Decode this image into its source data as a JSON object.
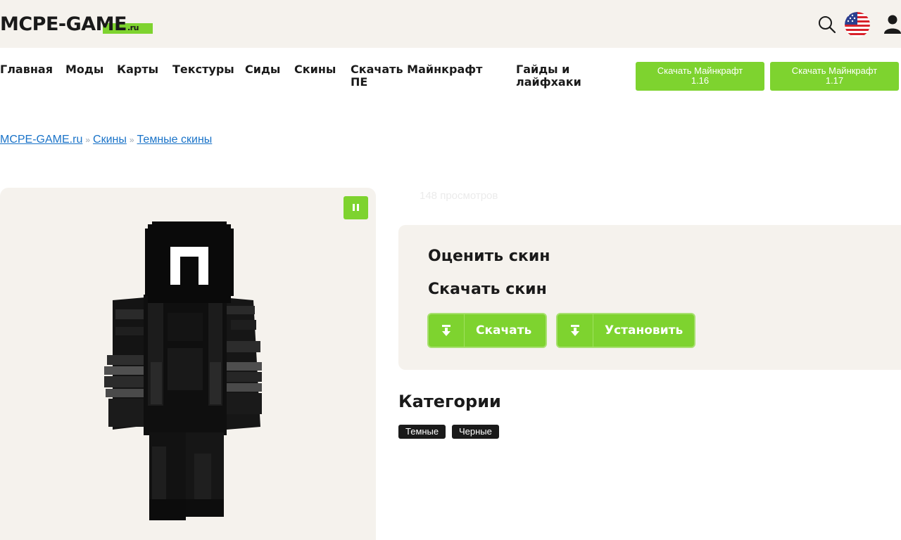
{
  "header": {
    "logo_main": "MCPE-GAME",
    "logo_suffix": ".ru",
    "brand_color": "#7ed32f",
    "icons": [
      "search-icon",
      "us-flag-icon",
      "user-icon"
    ]
  },
  "nav": {
    "items": [
      {
        "label": "Главная"
      },
      {
        "label": "Моды"
      },
      {
        "label": "Карты"
      },
      {
        "label": "Текстуры"
      },
      {
        "label": "Сиды"
      },
      {
        "label": "Скины"
      },
      {
        "label": "Скачать Майнкрафт ПЕ"
      },
      {
        "label": "Гайды и лайфхаки"
      }
    ],
    "buttons": [
      {
        "line1": "Скачать Майнкрафт",
        "line2": "1.16"
      },
      {
        "line1": "Скачать Майнкрафт",
        "line2": "1.17"
      }
    ]
  },
  "breadcrumb": {
    "items": [
      "MCPE-GAME.ru",
      "Скины",
      "Темные скины"
    ],
    "separator": "»"
  },
  "preview": {
    "pause_icon": "pause-icon"
  },
  "views": "148 просмотров",
  "panel": {
    "rate_title": "Оценить скин",
    "download_title": "Скачать скин",
    "download_label": "Скачать",
    "install_label": "Установить"
  },
  "categories": {
    "title": "Категории",
    "tags": [
      "Темные",
      "Черные"
    ]
  }
}
